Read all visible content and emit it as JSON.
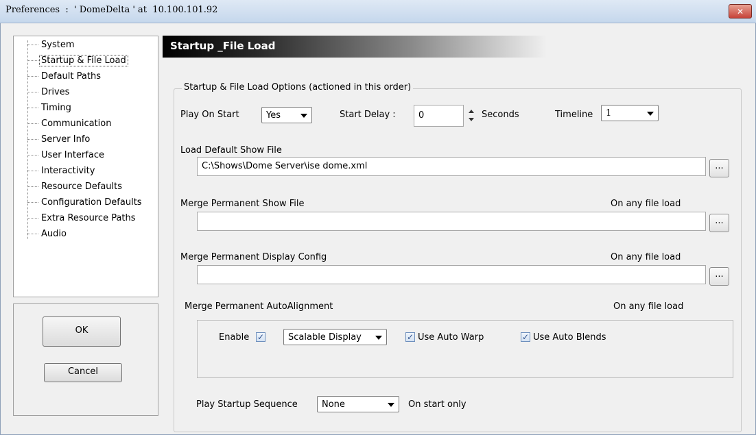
{
  "window": {
    "title": "Preferences  :  ' DomeDelta ' at  10.100.101.92",
    "close_glyph": "✕"
  },
  "sidebar": {
    "items": [
      {
        "label": "System"
      },
      {
        "label": "Startup & File Load",
        "selected": true
      },
      {
        "label": "Default Paths"
      },
      {
        "label": "Drives"
      },
      {
        "label": "Timing"
      },
      {
        "label": "Communication"
      },
      {
        "label": "Server Info"
      },
      {
        "label": "User Interface"
      },
      {
        "label": "Interactivity"
      },
      {
        "label": "Resource Defaults"
      },
      {
        "label": "Configuration Defaults"
      },
      {
        "label": "Extra Resource Paths"
      },
      {
        "label": "Audio"
      }
    ]
  },
  "buttons": {
    "ok": "OK",
    "cancel": "Cancel"
  },
  "main": {
    "header": "Startup _File Load",
    "group_title": "Startup & File Load Options (actioned in this order)",
    "play_on_start": {
      "label": "Play On Start",
      "value": "Yes"
    },
    "start_delay": {
      "label": "Start Delay :",
      "value": "0",
      "unit": "Seconds"
    },
    "timeline": {
      "label": "Timeline",
      "value": "1"
    },
    "load_default_show": {
      "label": "Load Default Show File",
      "value": "C:\\Shows\\Dome Server\\ise dome.xml",
      "browse": "..."
    },
    "merge_show": {
      "label": "Merge Permanent Show File",
      "note": "On any file load",
      "value": "",
      "browse": "..."
    },
    "merge_display": {
      "label": "Merge Permanent Display Config",
      "note": "On any file load",
      "value": "",
      "browse": "..."
    },
    "merge_autoalign": {
      "label": "Merge Permanent AutoAlignment",
      "note": "On any file load",
      "enable_label": "Enable",
      "enable_checked": true,
      "display_type": "Scalable Display",
      "auto_warp_label": "Use Auto Warp",
      "auto_warp_checked": true,
      "auto_blends_label": "Use Auto Blends",
      "auto_blends_checked": true
    },
    "startup_sequence": {
      "label": "Play Startup Sequence",
      "value": "None",
      "note": "On start only"
    }
  },
  "check_glyph": "✓"
}
